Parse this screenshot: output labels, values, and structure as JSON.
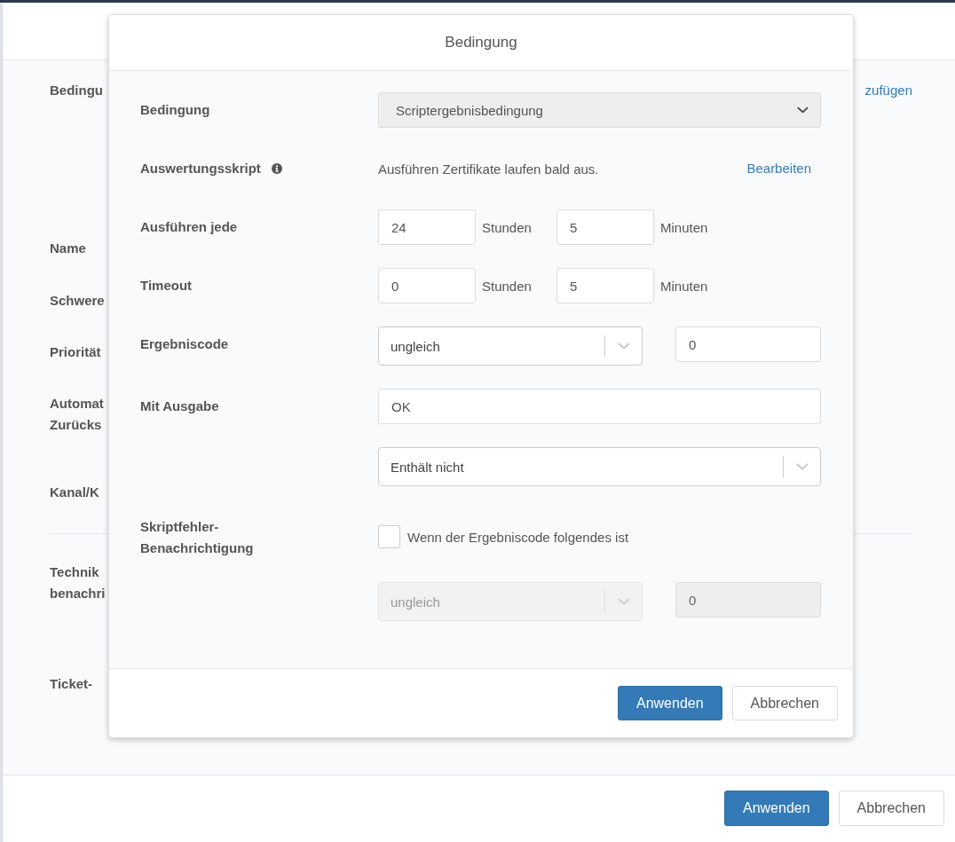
{
  "page": {
    "panel": {
      "add_link": "zufügen",
      "labels": [
        {
          "kind": "label",
          "text": "Bedingu"
        },
        {
          "kind": "label",
          "text": "Name"
        },
        {
          "kind": "label",
          "text": "Schwere"
        },
        {
          "kind": "label",
          "text": "Priorität"
        },
        {
          "kind": "label",
          "text": "Automat Zurücks"
        },
        {
          "kind": "label",
          "text": "Kanal/K"
        },
        {
          "kind": "divider"
        },
        {
          "kind": "label",
          "text": "Technik benachri"
        },
        {
          "kind": "label",
          "text": "Ticket-"
        }
      ],
      "buttons": [
        {
          "label": "Anwenden",
          "kind": "primary"
        },
        {
          "label": "Abbrechen",
          "kind": "secondary"
        }
      ]
    }
  },
  "dialog": {
    "title": "Bedingung",
    "rows": [
      {
        "kind": "select",
        "label": "Bedingung",
        "value": "Scriptergebnisbedingung",
        "disabled": true
      },
      {
        "kind": "script",
        "label": "Auswertungsskript",
        "text": "Ausführen Zertifikate laufen bald aus.",
        "link": "Bearbeiten"
      },
      {
        "kind": "interval",
        "label": "Ausführen jede",
        "hours": "24",
        "hours_unit": "Stunden",
        "minutes": "5",
        "minutes_unit": "Minuten"
      },
      {
        "kind": "interval",
        "label": "Timeout",
        "hours": "0",
        "hours_unit": "Stunden",
        "minutes": "5",
        "minutes_unit": "Minuten"
      },
      {
        "kind": "compare",
        "label": "Ergebniscode",
        "operator": "ungleich",
        "value": "0",
        "disabled": false
      },
      {
        "kind": "text",
        "label": "Mit Ausgabe",
        "value": "OK"
      },
      {
        "kind": "dropdown",
        "value": "Enthält nicht"
      },
      {
        "kind": "checkbox",
        "label": "Skriptfehler-Benachrichtigung",
        "text": "Wenn der Ergebniscode folgendes ist",
        "checked": false
      },
      {
        "kind": "compare",
        "operator": "ungleich",
        "value": "0",
        "disabled": true
      }
    ],
    "buttons": [
      {
        "label": "Anwenden",
        "kind": "primary"
      },
      {
        "label": "Abbrechen",
        "kind": "secondary"
      }
    ]
  }
}
